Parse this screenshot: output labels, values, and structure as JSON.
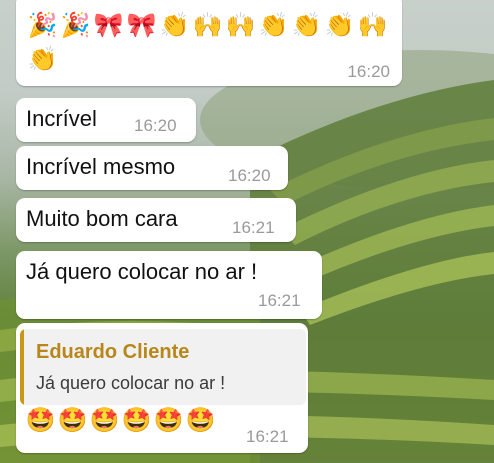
{
  "messages": [
    {
      "kind": "emoji",
      "emoji_rows": [
        [
          "🎉",
          "🎉",
          "🎀",
          "🎀",
          "👏",
          "🙌",
          "🙌",
          "👏",
          "👏",
          "👏",
          "🙌"
        ],
        [
          "👏"
        ]
      ],
      "time": "16:20"
    },
    {
      "kind": "text",
      "text": "Incrível",
      "time": "16:20"
    },
    {
      "kind": "text",
      "text": "Incrível mesmo",
      "time": "16:20"
    },
    {
      "kind": "text",
      "text": "Muito bom cara",
      "time": "16:21"
    },
    {
      "kind": "text",
      "text": "Já quero colocar no ar !",
      "time": "16:21"
    },
    {
      "kind": "reply",
      "quote": {
        "author": "Eduardo Cliente",
        "text": "Já quero colocar no ar !"
      },
      "emojis": [
        "🤩",
        "🤩",
        "🤩",
        "🤩",
        "🤩",
        "🤩"
      ],
      "time": "16:21"
    }
  ],
  "colors": {
    "bubble": "#ffffff",
    "time": "#9a9a9a",
    "quote_accent": "#c79718",
    "quote_author": "#b8861b"
  }
}
